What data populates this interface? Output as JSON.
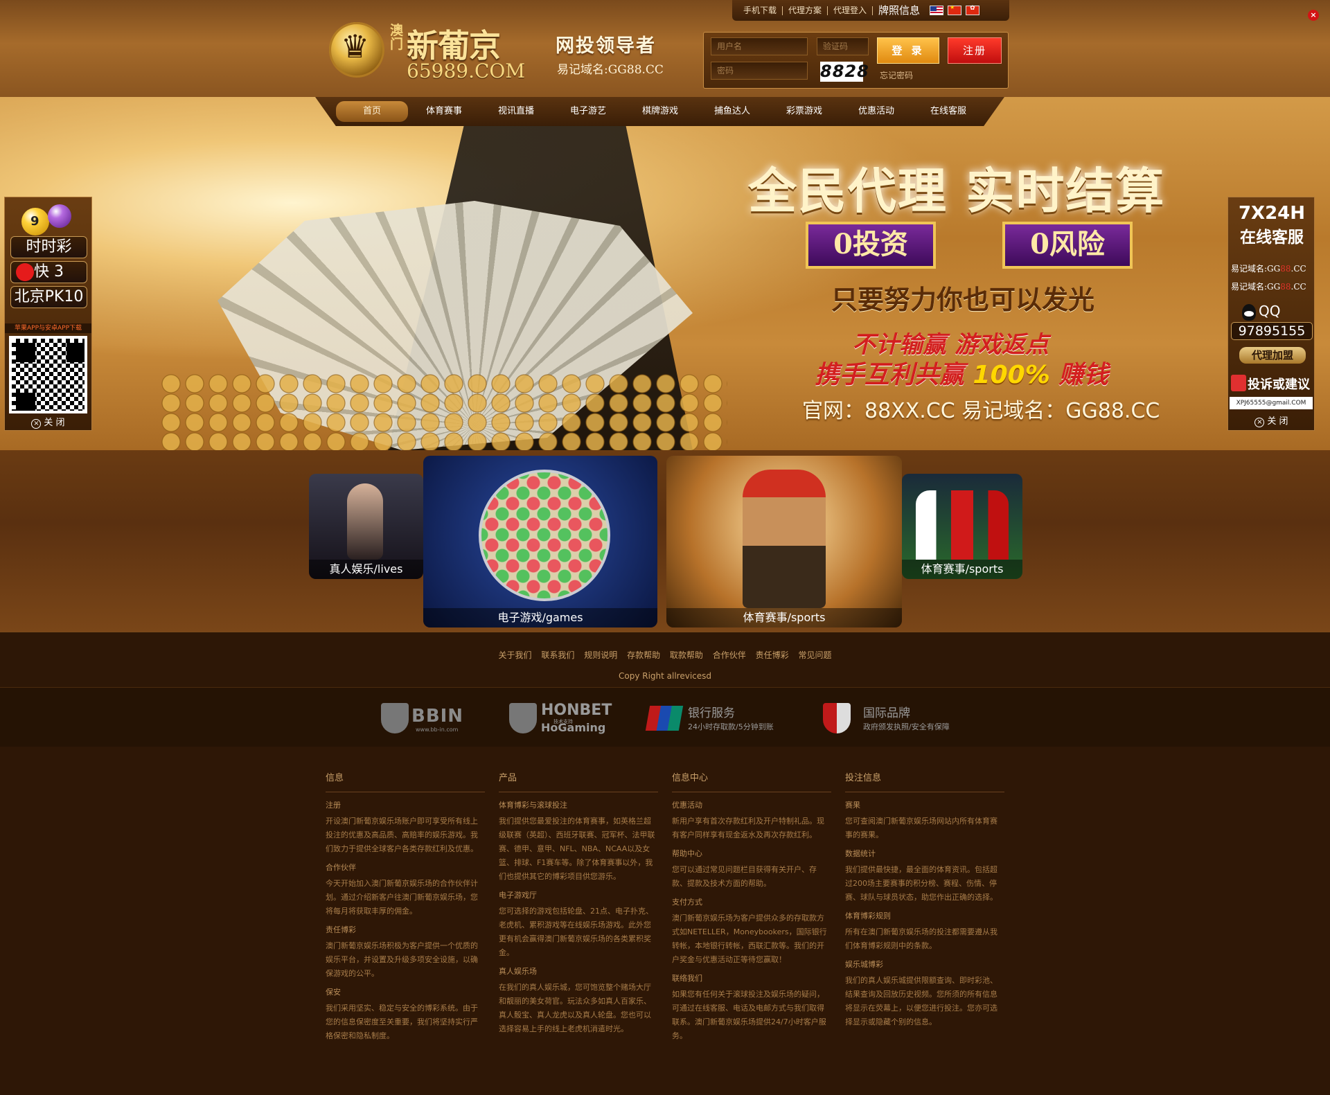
{
  "top_links": {
    "mobile_download": "手机下载",
    "agent_plan": "代理方案",
    "agent_login": "代理登入",
    "license": "牌照信息"
  },
  "logo": {
    "macau": "澳门",
    "name": "新葡京",
    "domain": "65989.COM"
  },
  "slogan": {
    "main": "网投领导者",
    "sub": "易记域名:GG88.CC"
  },
  "login": {
    "username_placeholder": "用户名",
    "password_placeholder": "密码",
    "captcha_placeholder": "验证码",
    "captcha_code": "8828",
    "login_label": "登 录",
    "register_label": "注册",
    "forgot_label": "忘记密码"
  },
  "nav": {
    "items": [
      "首页",
      "体育赛事",
      "视讯直播",
      "电子游艺",
      "棋牌游戏",
      "捕鱼达人",
      "彩票游戏",
      "优惠活动",
      "在线客服"
    ]
  },
  "banner": {
    "title": "全民代理  实时结算",
    "badge1": "0投资",
    "badge2": "0风险",
    "line2": "只要努力你也可以发光",
    "line3": "不计输赢 游戏返点",
    "line4_prefix": "携手互利共赢 ",
    "line4_highlight": "100%",
    "line4_suffix": " 赚钱",
    "line5": "官网：88XX.CC  易记域名：GG88.CC"
  },
  "left_panel": {
    "ball_9": "9",
    "lottery1": "时时彩",
    "lottery2": "快 3",
    "lottery3": "北京PK10",
    "download": "苹果APP与安卓APP下载",
    "close": "关 闭"
  },
  "right_panel": {
    "title1": "7X24H",
    "title2": "在线客服",
    "domain1_prefix": "易记域名:GG",
    "domain1_mask": "88",
    "domain1_suffix": ".CC",
    "domain2_prefix": "易记域名:GG",
    "domain2_mask": "88",
    "domain2_suffix": ".CC",
    "qq_label": "QQ",
    "qq_number": "97895155",
    "agent": "代理加盟",
    "complaint": "投诉或建议",
    "email": "XPJ65555@gmail.COM",
    "close": "关 闭"
  },
  "cards": {
    "lives": "真人娱乐/lives",
    "games": "电子游戏/games",
    "sports_center": "体育赛事/sports",
    "sports": "体育赛事/sports"
  },
  "footer": {
    "links": [
      "关于我们",
      "联系我们",
      "规则说明",
      "存款帮助",
      "取款帮助",
      "合作伙伴",
      "责任博彩",
      "常见问题"
    ],
    "copyright": "Copy Right allrevicesd"
  },
  "partners": {
    "bbin": "BBIN",
    "bbin_sub": "www.bb-in.com",
    "hon_name": "HONBET",
    "hon_tag": "技术支持",
    "hon_sub": "HoGaming",
    "bank_name": "银行服务",
    "bank_sub": "24小时存取款/5分钟到账",
    "intl_name": "国际品牌",
    "intl_sub": "政府颁发执照/安全有保障"
  },
  "info": {
    "col1": {
      "title": "信息",
      "items": [
        {
          "title": "注册",
          "text": "开设澳门新葡京娱乐场账户即可享受所有线上投注的优惠及高品质、高赔率的娱乐游戏。我们致力于提供全球客户各类存款红利及优惠。"
        },
        {
          "title": "合作伙伴",
          "text": "今天开始加入澳门新葡京娱乐场的合作伙伴计划。通过介绍新客户往澳门新葡京娱乐场，您将每月将获取丰厚的佣金。"
        },
        {
          "title": "责任博彩",
          "text": "澳门新葡京娱乐场积极为客户提供一个优质的娱乐平台，并设置及升级多项安全设施，以确保游戏的公平。"
        },
        {
          "title": "保安",
          "text": "我们采用坚实、稳定与安全的博彩系统。由于您的信息保密度至关重要，我们将坚持实行严格保密和隐私制度。"
        }
      ]
    },
    "col2": {
      "title": "产品",
      "items": [
        {
          "title": "体育博彩与滚球投注",
          "text": "我们提供您最爱投注的体育赛事，如英格兰超级联赛（英超）、西班牙联赛、冠军杯、法甲联赛、德甲、意甲、NFL、NBA、NCAA以及女篮、排球、F1赛车等。除了体育赛事以外，我们也提供其它的博彩项目供您游乐。"
        },
        {
          "title": "电子游戏厅",
          "text": "您可选择的游戏包括轮盘、21点、电子扑克、老虎机、累积游戏等在线娱乐场游戏。此外您更有机会赢得澳门新葡京娱乐场的各类累积奖金。"
        },
        {
          "title": "真人娱乐场",
          "text": "在我们的真人娱乐城，您可饱览整个赌场大厅和靓丽的美女荷官。玩法众多如真人百家乐、真人骰宝、真人龙虎以及真人轮盘。您也可以选择容易上手的线上老虎机消遣时光。"
        }
      ]
    },
    "col3": {
      "title": "信息中心",
      "items": [
        {
          "title": "优惠活动",
          "text": "新用户享有首次存款红利及开户特制礼品。现有客户同样享有现金返水及再次存款红利。"
        },
        {
          "title": "帮助中心",
          "text": "您可以通过常见问题栏目获得有关开户、存款、提款及技术方面的帮助。"
        },
        {
          "title": "支付方式",
          "text": "澳门新葡京娱乐场为客户提供众多的存取款方式如NETELLER，Moneybookers，国际银行转帐，本地银行转帐，西联汇款等。我们的开户奖金与优惠活动正等待您赢取！"
        },
        {
          "title": "联络我们",
          "text": "如果您有任何关于滚球投注及娱乐场的疑问，可通过在线客服、电话及电邮方式与我们取得联系。澳门新葡京娱乐场提供24/7小时客户服务。"
        }
      ]
    },
    "col4": {
      "title": "投注信息",
      "items": [
        {
          "title": "赛果",
          "text": "您可查阅澳门新葡京娱乐场网站内所有体育赛事的赛果。"
        },
        {
          "title": "数据统计",
          "text": "我们提供最快捷，最全面的体育资讯。包括超过200场主要赛事的积分榜、赛程、伤情、停赛、球队与球员状态，助您作出正确的选择。"
        },
        {
          "title": "体育博彩规则",
          "text": "所有在澳门新葡京娱乐场的投注都需要遵从我们体育博彩规则中的条款。"
        },
        {
          "title": "娱乐城博彩",
          "text": "我们的真人娱乐城提供限额查询、即时彩池、结果查询及回放历史视频。您所须的所有信息将显示在荧幕上，以便您进行投注。您亦可选择显示或隐藏个别的信息。"
        }
      ]
    }
  }
}
